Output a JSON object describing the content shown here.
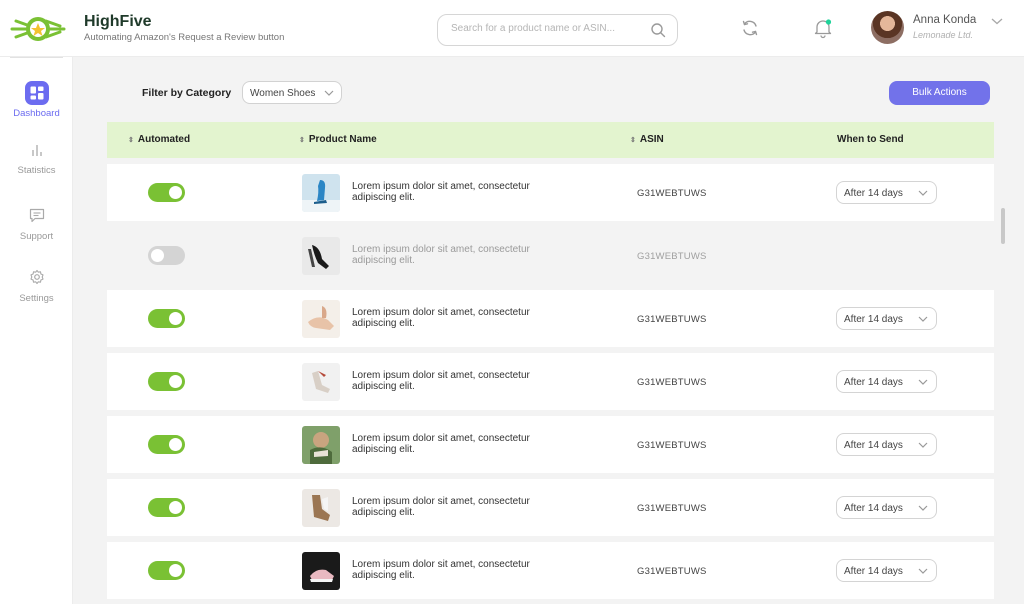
{
  "app": {
    "name": "HighFive",
    "tagline": "Automating Amazon's Request a Review button"
  },
  "search": {
    "placeholder": "Search for a product name or ASIN..."
  },
  "user": {
    "name": "Anna Konda",
    "company": "Lemonade Ltd."
  },
  "sidebar": {
    "items": [
      {
        "label": "Dashboard",
        "icon": "dashboard-icon",
        "active": true
      },
      {
        "label": "Statistics",
        "icon": "bar-chart-icon",
        "active": false
      },
      {
        "label": "Support",
        "icon": "chat-icon",
        "active": false
      },
      {
        "label": "Settings",
        "icon": "gear-icon",
        "active": false
      }
    ]
  },
  "filter": {
    "label": "Filter by Category",
    "value": "Women Shoes"
  },
  "bulk_actions_label": "Bulk Actions",
  "table": {
    "columns": [
      "Automated",
      "Product Name",
      "ASIN",
      "When to Send"
    ],
    "rows": [
      {
        "automated": true,
        "product": "Lorem ipsum dolor sit amet, consectetur adipiscing elit.",
        "asin": "G31WEBTUWS",
        "send": "After 14 days"
      },
      {
        "automated": false,
        "product": "Lorem ipsum dolor sit amet, consectetur adipiscing elit.",
        "asin": "G31WEBTUWS",
        "send": ""
      },
      {
        "automated": true,
        "product": "Lorem ipsum dolor sit amet, consectetur adipiscing elit.",
        "asin": "G31WEBTUWS",
        "send": "After 14 days"
      },
      {
        "automated": true,
        "product": "Lorem ipsum dolor sit amet, consectetur adipiscing elit.",
        "asin": "G31WEBTUWS",
        "send": "After 14 days"
      },
      {
        "automated": true,
        "product": "Lorem ipsum dolor sit amet, consectetur adipiscing elit.",
        "asin": "G31WEBTUWS",
        "send": "After 14 days"
      },
      {
        "automated": true,
        "product": "Lorem ipsum dolor sit amet, consectetur adipiscing elit.",
        "asin": "G31WEBTUWS",
        "send": "After 14 days"
      },
      {
        "automated": true,
        "product": "Lorem ipsum dolor sit amet, consectetur adipiscing elit.",
        "asin": "G31WEBTUWS",
        "send": "After 14 days"
      }
    ]
  },
  "colors": {
    "accent": "#6c6cf0",
    "toggle_on": "#7ac134",
    "header_row": "#e3f4cf"
  }
}
